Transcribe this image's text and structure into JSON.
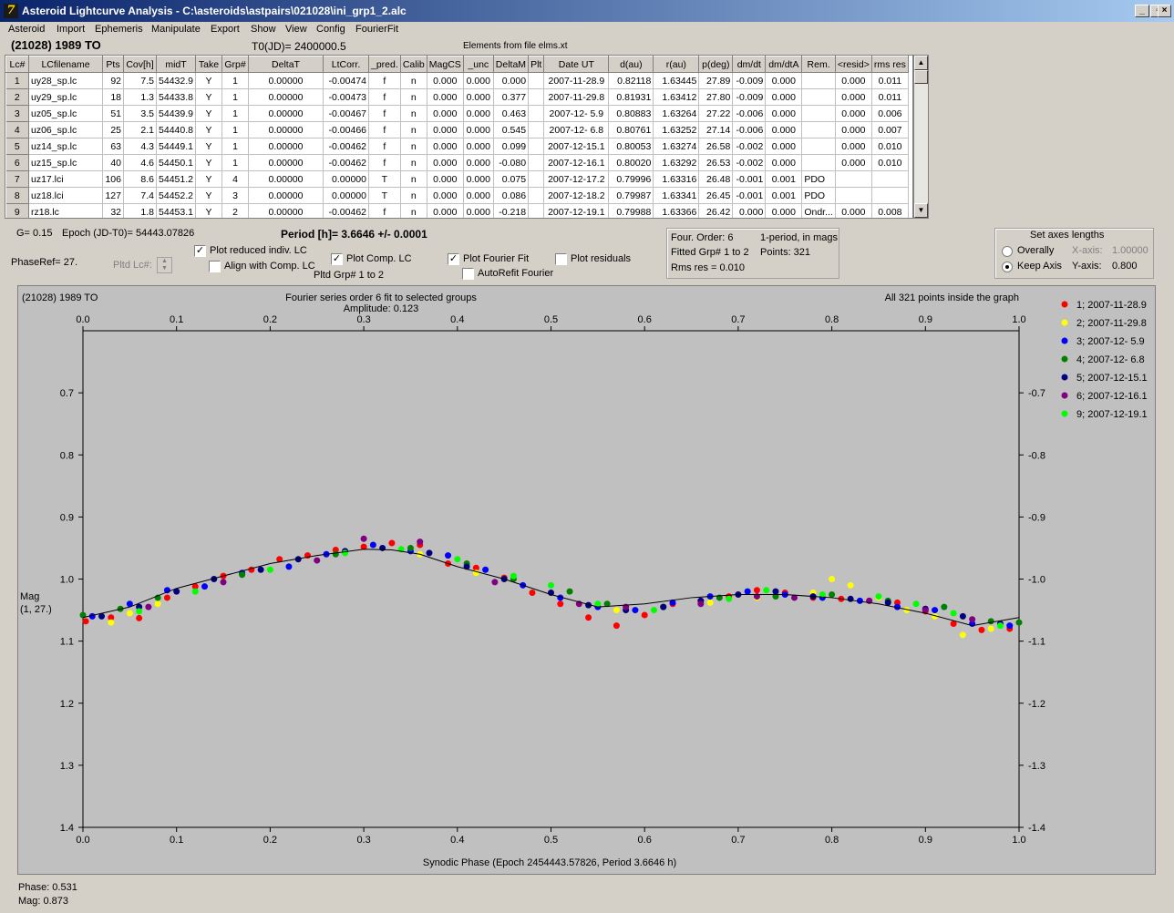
{
  "window": {
    "title": "Asteroid Lightcurve Analysis - C:\\asteroids\\astpairs\\021028\\ini_grp1_2.alc",
    "app_icon": "7"
  },
  "menu": [
    "Asteroid",
    "Import",
    "Ephemeris",
    "Manipulate",
    "Export",
    "Show",
    "View",
    "Config",
    "FourierFit"
  ],
  "header": {
    "object": "(21028) 1989 TO",
    "t0": "T0(JD)= 2400000.5",
    "elements": "Elements from file elms.xt"
  },
  "table": {
    "columns": [
      "Lc#",
      "LCfilename",
      "Pts",
      "Cov[h]",
      "midT",
      "Take",
      "Grp#",
      "DeltaT",
      "LtCorr.",
      "_pred.",
      "Calib",
      "MagCS",
      "_unc",
      "DeltaM",
      "Plt",
      "Date UT",
      "d(au)",
      "r(au)",
      "p(deg)",
      "dm/dt",
      "dm/dtA",
      "Rem.",
      "<resid>",
      "rms res"
    ],
    "rows": [
      [
        "1",
        "uy28_sp.lc",
        "92",
        "7.5",
        "54432.9",
        "Y",
        "1",
        "0.00000",
        "-0.00474",
        "f",
        "n",
        "0.000",
        "0.000",
        "0.000",
        "",
        "2007-11-28.9",
        "0.82118",
        "1.63445",
        "27.89",
        "-0.009",
        "0.000",
        "",
        "0.000",
        "0.011"
      ],
      [
        "2",
        "uy29_sp.lc",
        "18",
        "1.3",
        "54433.8",
        "Y",
        "1",
        "0.00000",
        "-0.00473",
        "f",
        "n",
        "0.000",
        "0.000",
        "0.377",
        "",
        "2007-11-29.8",
        "0.81931",
        "1.63412",
        "27.80",
        "-0.009",
        "0.000",
        "",
        "0.000",
        "0.011"
      ],
      [
        "3",
        "uz05_sp.lc",
        "51",
        "3.5",
        "54439.9",
        "Y",
        "1",
        "0.00000",
        "-0.00467",
        "f",
        "n",
        "0.000",
        "0.000",
        "0.463",
        "",
        "2007-12- 5.9",
        "0.80883",
        "1.63264",
        "27.22",
        "-0.006",
        "0.000",
        "",
        "0.000",
        "0.006"
      ],
      [
        "4",
        "uz06_sp.lc",
        "25",
        "2.1",
        "54440.8",
        "Y",
        "1",
        "0.00000",
        "-0.00466",
        "f",
        "n",
        "0.000",
        "0.000",
        "0.545",
        "",
        "2007-12- 6.8",
        "0.80761",
        "1.63252",
        "27.14",
        "-0.006",
        "0.000",
        "",
        "0.000",
        "0.007"
      ],
      [
        "5",
        "uz14_sp.lc",
        "63",
        "4.3",
        "54449.1",
        "Y",
        "1",
        "0.00000",
        "-0.00462",
        "f",
        "n",
        "0.000",
        "0.000",
        "0.099",
        "",
        "2007-12-15.1",
        "0.80053",
        "1.63274",
        "26.58",
        "-0.002",
        "0.000",
        "",
        "0.000",
        "0.010"
      ],
      [
        "6",
        "uz15_sp.lc",
        "40",
        "4.6",
        "54450.1",
        "Y",
        "1",
        "0.00000",
        "-0.00462",
        "f",
        "n",
        "0.000",
        "0.000",
        "-0.080",
        "",
        "2007-12-16.1",
        "0.80020",
        "1.63292",
        "26.53",
        "-0.002",
        "0.000",
        "",
        "0.000",
        "0.010"
      ],
      [
        "7",
        "uz17.lci",
        "106",
        "8.6",
        "54451.2",
        "Y",
        "4",
        "0.00000",
        "0.00000",
        "T",
        "n",
        "0.000",
        "0.000",
        "0.075",
        "",
        "2007-12-17.2",
        "0.79996",
        "1.63316",
        "26.48",
        "-0.001",
        "0.001",
        "PDO",
        "",
        ""
      ],
      [
        "8",
        "uz18.lci",
        "127",
        "7.4",
        "54452.2",
        "Y",
        "3",
        "0.00000",
        "0.00000",
        "T",
        "n",
        "0.000",
        "0.000",
        "0.086",
        "",
        "2007-12-18.2",
        "0.79987",
        "1.63341",
        "26.45",
        "-0.001",
        "0.001",
        "PDO",
        "",
        ""
      ],
      [
        "9",
        "rz18.lc",
        "32",
        "1.8",
        "54453.1",
        "Y",
        "2",
        "0.00000",
        "-0.00462",
        "f",
        "n",
        "0.000",
        "0.000",
        "-0.218",
        "",
        "2007-12-19.1",
        "0.79988",
        "1.63366",
        "26.42",
        "0.000",
        "0.000",
        "Ondr...",
        "0.000",
        "0.008"
      ]
    ]
  },
  "controls": {
    "g": "G= 0.15",
    "epoch": "Epoch (JD-T0)= 54443.07826",
    "period": "Period [h]= 3.6646 +/- 0.0001",
    "phaseref": "PhaseRef= 27.",
    "pltd_lc": "Pltd Lc#:",
    "plot_reduced": "Plot reduced indiv. LC",
    "align_comp": "Align with Comp. LC",
    "plot_comp": "Plot Comp. LC",
    "pltd_grp": "Pltd Grp#  1   to   2",
    "plot_fourier": "Plot Fourier Fit",
    "autorefit": "AutoRefit Fourier",
    "plot_resid": "Plot residuals",
    "check_mark": "✓"
  },
  "fourier_info": {
    "order": "Four. Order:  6",
    "mode": "1-period, in mags",
    "fitted": "Fitted Grp# 1 to 2",
    "points": "Points: 321",
    "rms": "Rms res      = 0.010"
  },
  "axes_box": {
    "title": "Set axes lengths",
    "overally": "Overally",
    "keep_axis": "Keep Axis",
    "xaxis_label": "X-axis:",
    "xaxis_value": "1.00000",
    "yaxis_label": "Y-axis:",
    "yaxis_value": "0.800"
  },
  "status": {
    "phase": "Phase:  0.531",
    "mag": "Mag:    0.873"
  },
  "chart_data": {
    "type": "scatter",
    "title": "Fourier series order 6 fit to selected groups",
    "subtitle": "Amplitude: 0.123",
    "object_label": "(21028) 1989 TO",
    "note": "All 321 points inside the graph",
    "xlabel": "Synodic Phase (Epoch 2454443.57826, Period 3.6646 h)",
    "ylabel": "Mag",
    "ylabel2": "(1, 27.)",
    "xlim": [
      0.0,
      1.0
    ],
    "ylim": [
      1.4,
      0.6
    ],
    "x_ticks": [
      "0.0",
      "0.1",
      "0.2",
      "0.3",
      "0.4",
      "0.5",
      "0.6",
      "0.7",
      "0.8",
      "0.9",
      "1.0"
    ],
    "y_ticks": [
      "0.7",
      "0.8",
      "0.9",
      "1.0",
      "1.1",
      "1.2",
      "1.3",
      "1.4"
    ],
    "legend_position": "right",
    "fourier_curve": {
      "x": [
        0.0,
        0.05,
        0.1,
        0.15,
        0.2,
        0.25,
        0.3,
        0.33,
        0.36,
        0.4,
        0.45,
        0.5,
        0.55,
        0.6,
        0.65,
        0.7,
        0.75,
        0.8,
        0.85,
        0.9,
        0.95,
        1.0
      ],
      "y": [
        1.062,
        1.045,
        1.015,
        0.995,
        0.975,
        0.962,
        0.952,
        0.953,
        0.96,
        0.98,
        1.0,
        1.025,
        1.045,
        1.04,
        1.03,
        1.025,
        1.025,
        1.03,
        1.04,
        1.055,
        1.075,
        1.062
      ]
    },
    "series": [
      {
        "name": "1; 2007-11-28.9",
        "color": "#ff0000",
        "x": [
          0.003,
          0.03,
          0.06,
          0.09,
          0.12,
          0.15,
          0.18,
          0.21,
          0.24,
          0.27,
          0.3,
          0.33,
          0.36,
          0.39,
          0.42,
          0.45,
          0.48,
          0.51,
          0.54,
          0.57,
          0.6,
          0.63,
          0.66,
          0.69,
          0.72,
          0.75,
          0.78,
          0.81,
          0.84,
          0.87,
          0.9,
          0.93,
          0.96,
          0.99
        ],
        "y": [
          1.068,
          1.062,
          1.063,
          1.03,
          1.012,
          0.995,
          0.985,
          0.968,
          0.962,
          0.953,
          0.948,
          0.942,
          0.945,
          0.975,
          0.982,
          0.998,
          1.022,
          1.04,
          1.062,
          1.075,
          1.058,
          1.04,
          1.035,
          1.028,
          1.018,
          1.022,
          1.03,
          1.032,
          1.035,
          1.038,
          1.052,
          1.072,
          1.082,
          1.08
        ]
      },
      {
        "name": "2; 2007-11-29.8",
        "color": "#ffff00",
        "x": [
          0.03,
          0.05,
          0.08,
          0.31,
          0.36,
          0.42,
          0.52,
          0.57,
          0.62,
          0.67,
          0.72,
          0.78,
          0.8,
          0.82,
          0.85,
          0.88,
          0.91,
          0.94,
          0.97
        ],
        "y": [
          1.07,
          1.055,
          1.04,
          0.945,
          0.96,
          0.99,
          1.02,
          1.05,
          1.045,
          1.038,
          1.03,
          1.022,
          1.0,
          1.01,
          1.03,
          1.05,
          1.06,
          1.09,
          1.08
        ]
      },
      {
        "name": "3; 2007-12- 5.9",
        "color": "#0000ff",
        "x": [
          0.01,
          0.05,
          0.09,
          0.13,
          0.17,
          0.22,
          0.26,
          0.31,
          0.35,
          0.39,
          0.43,
          0.47,
          0.51,
          0.55,
          0.59,
          0.63,
          0.67,
          0.71,
          0.75,
          0.79,
          0.83,
          0.87,
          0.91,
          0.95,
          0.99
        ],
        "y": [
          1.06,
          1.04,
          1.018,
          1.012,
          0.99,
          0.98,
          0.96,
          0.945,
          0.955,
          0.962,
          0.985,
          1.01,
          1.03,
          1.045,
          1.05,
          1.038,
          1.028,
          1.02,
          1.025,
          1.03,
          1.035,
          1.045,
          1.05,
          1.072,
          1.075
        ]
      },
      {
        "name": "4; 2007-12- 6.8",
        "color": "#008000",
        "x": [
          0.0,
          0.04,
          0.08,
          0.17,
          0.27,
          0.35,
          0.41,
          0.46,
          0.52,
          0.56,
          0.62,
          0.68,
          0.74,
          0.8,
          0.86,
          0.92,
          0.97,
          1.0
        ],
        "y": [
          1.058,
          1.048,
          1.03,
          0.993,
          0.96,
          0.95,
          0.975,
          1.0,
          1.02,
          1.04,
          1.045,
          1.03,
          1.028,
          1.025,
          1.035,
          1.045,
          1.068,
          1.07
        ]
      },
      {
        "name": "5; 2007-12-15.1",
        "color": "#000080",
        "x": [
          0.02,
          0.06,
          0.1,
          0.14,
          0.19,
          0.23,
          0.28,
          0.32,
          0.37,
          0.41,
          0.45,
          0.5,
          0.54,
          0.58,
          0.62,
          0.66,
          0.7,
          0.74,
          0.78,
          0.82,
          0.86,
          0.9,
          0.94,
          0.98
        ],
        "y": [
          1.06,
          1.045,
          1.02,
          1.0,
          0.985,
          0.968,
          0.955,
          0.95,
          0.958,
          0.98,
          1.0,
          1.022,
          1.042,
          1.05,
          1.045,
          1.035,
          1.025,
          1.02,
          1.028,
          1.032,
          1.038,
          1.048,
          1.06,
          1.072
        ]
      },
      {
        "name": "6; 2007-12-16.1",
        "color": "#800080",
        "x": [
          0.07,
          0.15,
          0.25,
          0.3,
          0.36,
          0.44,
          0.53,
          0.58,
          0.66,
          0.72,
          0.76,
          0.84,
          0.9,
          0.95
        ],
        "y": [
          1.045,
          1.005,
          0.97,
          0.935,
          0.94,
          1.005,
          1.04,
          1.045,
          1.04,
          1.028,
          1.03,
          1.035,
          1.05,
          1.065
        ]
      },
      {
        "name": "9; 2007-12-19.1",
        "color": "#00ff00",
        "x": [
          0.06,
          0.12,
          0.2,
          0.28,
          0.34,
          0.4,
          0.46,
          0.5,
          0.55,
          0.61,
          0.69,
          0.73,
          0.79,
          0.85,
          0.89,
          0.93,
          0.98
        ],
        "y": [
          1.052,
          1.02,
          0.985,
          0.958,
          0.952,
          0.968,
          0.995,
          1.01,
          1.04,
          1.05,
          1.032,
          1.018,
          1.025,
          1.028,
          1.04,
          1.055,
          1.075
        ]
      }
    ]
  }
}
